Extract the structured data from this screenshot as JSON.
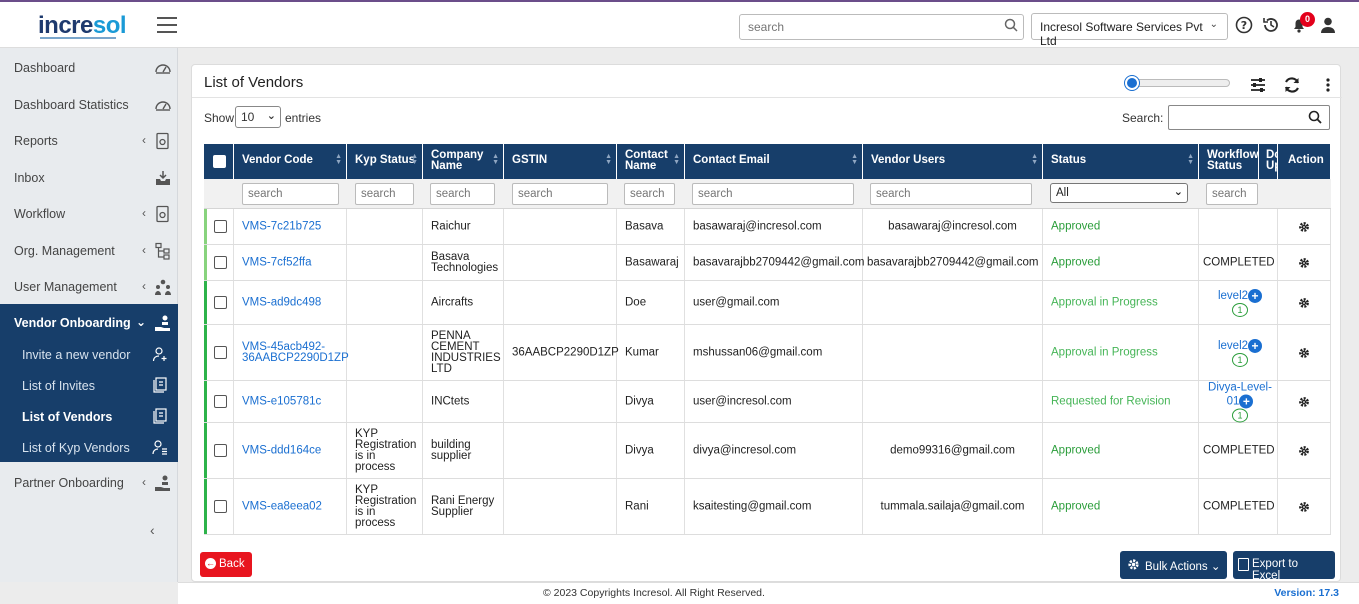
{
  "brand": {
    "part1": "incre",
    "part2": "sol"
  },
  "header": {
    "search_placeholder": "search",
    "company": "Incresol Software Services Pvt Ltd",
    "notifications": "0"
  },
  "sidebar": {
    "items": [
      {
        "label": "Dashboard",
        "icon": "gauge-icon"
      },
      {
        "label": "Dashboard Statistics",
        "icon": "gauge-icon"
      },
      {
        "label": "Reports",
        "icon": "report-gear-icon"
      },
      {
        "label": "Inbox",
        "icon": "inbox-icon"
      },
      {
        "label": "Workflow",
        "icon": "workflow-gear-icon"
      },
      {
        "label": "Org. Management",
        "icon": "org-tree-icon"
      },
      {
        "label": "User Management",
        "icon": "users-gear-icon"
      },
      {
        "label": "Vendor Onboarding",
        "icon": "hand-user-icon"
      },
      {
        "label": "Partner Onboarding",
        "icon": "hand-user-icon"
      }
    ],
    "sub_items": [
      {
        "label": "Invite a new vendor"
      },
      {
        "label": "List of Invites"
      },
      {
        "label": "List of Vendors"
      },
      {
        "label": "List of Kyp Vendors"
      }
    ]
  },
  "page": {
    "title": "List of Vendors",
    "show_label": "Show",
    "entries_value": "10",
    "entries_label": "entries",
    "search_label": "Search:"
  },
  "table": {
    "columns": [
      "Vendor Code",
      "Kyp Status",
      "Company Name",
      "GSTIN",
      "Contact Name",
      "Contact Email",
      "Vendor Users",
      "Status",
      "Workflow Status",
      "Doc Upl",
      "Action"
    ],
    "filter_placeholder": "search",
    "status_filter": "All",
    "rows": [
      {
        "code": "VMS-7c21b725",
        "kyp": "",
        "company": "Raichur",
        "gstin": "",
        "contact": "Basava",
        "email": "basawaraj@incresol.com",
        "users": "basawaraj@incresol.com",
        "status": "Approved",
        "workflow": "",
        "wf_count": ""
      },
      {
        "code": "VMS-7cf52ffa",
        "kyp": "",
        "company": "Basava Technologies",
        "gstin": "",
        "contact": "Basawaraj",
        "email": "basavarajbb2709442@gmail.com",
        "users": "basavarajbb2709442@gmail.com",
        "status": "Approved",
        "workflow": "COMPLETED",
        "wf_count": ""
      },
      {
        "code": "VMS-ad9dc498",
        "kyp": "",
        "company": "Aircrafts",
        "gstin": "",
        "contact": "Doe",
        "email": "user@gmail.com",
        "users": "",
        "status": "Approval in Progress",
        "workflow": "level2",
        "wf_count": "1"
      },
      {
        "code": "VMS-45acb492-36AABCP2290D1ZP",
        "kyp": "",
        "company": "PENNA CEMENT INDUSTRIES LTD",
        "gstin": "36AABCP2290D1ZP",
        "contact": "Kumar",
        "email": "mshussan06@gmail.com",
        "users": "",
        "status": "Approval in Progress",
        "workflow": "level2",
        "wf_count": "1"
      },
      {
        "code": "VMS-e105781c",
        "kyp": "",
        "company": "INCtets",
        "gstin": "",
        "contact": "Divya",
        "email": "user@incresol.com",
        "users": "",
        "status": "Requested for Revision",
        "workflow": "Divya-Level-01",
        "wf_count": "1"
      },
      {
        "code": "VMS-ddd164ce",
        "kyp": "KYP Registration is in process",
        "company": "building supplier",
        "gstin": "",
        "contact": "Divya",
        "email": "divya@incresol.com",
        "users": "demo99316@gmail.com",
        "status": "Approved",
        "workflow": "COMPLETED",
        "wf_count": ""
      },
      {
        "code": "VMS-ea8eea02",
        "kyp": "KYP Registration is in process",
        "company": "Rani Energy Supplier",
        "gstin": "",
        "contact": "Rani",
        "email": "ksaitesting@gmail.com",
        "users": "tummala.sailaja@gmail.com",
        "status": "Approved",
        "workflow": "COMPLETED",
        "wf_count": ""
      }
    ]
  },
  "buttons": {
    "back": "Back",
    "bulk_actions": "Bulk Actions",
    "export": "Export to Excel"
  },
  "footer": {
    "copyright": "© 2023 Copyrights Incresol. All Right Reserved.",
    "version": "Version: 17.3"
  },
  "colors": {
    "navy": "#173e6a",
    "link": "#1a6fd1",
    "approved": "#2a9d3a",
    "danger": "#e8151f"
  }
}
